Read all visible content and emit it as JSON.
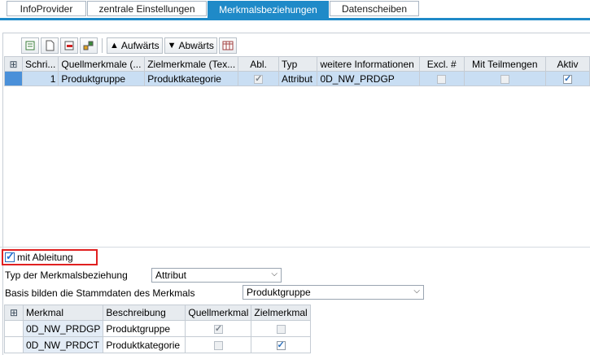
{
  "tabs": [
    {
      "label": "InfoProvider"
    },
    {
      "label": "zentrale Einstellungen"
    },
    {
      "label": "Merkmalsbeziehungen"
    },
    {
      "label": "Datenscheiben"
    }
  ],
  "toolbar": {
    "up_label": "Aufwärts",
    "down_label": "Abwärts"
  },
  "grid": {
    "columns": [
      "Schri...",
      "Quellmerkmale (...",
      "Zielmerkmale (Tex...",
      "Abl.",
      "Typ",
      "weitere Informationen",
      "Excl. #",
      "Mit Teilmengen",
      "Aktiv"
    ],
    "rows": [
      {
        "step": "1",
        "source": "Produktgruppe",
        "target": "Produktkategorie",
        "abl": true,
        "type": "Attribut",
        "info": "0D_NW_PRDGP",
        "excl": false,
        "subsets": false,
        "active": true
      }
    ]
  },
  "derivation": {
    "label": "mit Ableitung",
    "checked": true
  },
  "relation_type": {
    "label": "Typ der Merkmalsbeziehung",
    "value": "Attribut"
  },
  "basis": {
    "label": "Basis bilden die Stammdaten des Merkmals",
    "value": "Produktgruppe"
  },
  "grid2": {
    "columns": [
      "Merkmal",
      "Beschreibung",
      "Quellmerkmal",
      "Zielmerkmal"
    ],
    "rows": [
      {
        "merkmal": "0D_NW_PRDGP",
        "desc": "Produktgruppe",
        "source": true,
        "target": false
      },
      {
        "merkmal": "0D_NW_PRDCT",
        "desc": "Produktkategorie",
        "source": false,
        "target": true
      }
    ]
  }
}
